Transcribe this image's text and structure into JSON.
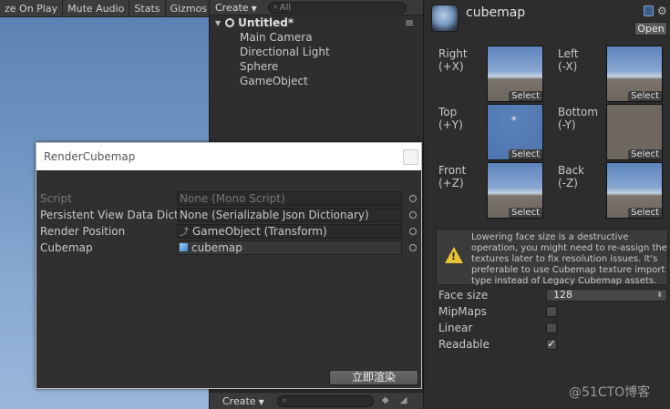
{
  "game_toolbar": {
    "items": [
      "ze On Play",
      "Mute Audio",
      "Stats",
      "Gizmos ▾"
    ]
  },
  "hierarchy": {
    "create_label": "Create",
    "search_placeholder": "All",
    "scene_name": "Untitled*",
    "items": [
      "Main Camera",
      "Directional Light",
      "Sphere",
      "GameObject"
    ],
    "bottom_create_label": "Create"
  },
  "inspector": {
    "asset_name": "cubemap",
    "open_label": "Open",
    "faces": [
      {
        "label": "Right\n(+X)",
        "select": "Select",
        "sky": "side"
      },
      {
        "label": "Left\n(-X)",
        "select": "Select",
        "sky": "side"
      },
      {
        "label": "Top\n(+Y)",
        "select": "Select",
        "sky": "top"
      },
      {
        "label": "Bottom\n(-Y)",
        "select": "Select",
        "sky": "bottom"
      },
      {
        "label": "Front\n(+Z)",
        "select": "Select",
        "sky": "side"
      },
      {
        "label": "Back\n(-Z)",
        "select": "Select",
        "sky": "side"
      }
    ],
    "warning": "Lowering face size is a destructive operation, you might need to re-assign the textures later to fix resolution issues. It's preferable to use Cubemap texture import type instead of Legacy Cubemap assets.",
    "face_size_label": "Face size",
    "face_size_value": "128",
    "mipmaps_label": "MipMaps",
    "mipmaps_checked": false,
    "linear_label": "Linear",
    "linear_checked": false,
    "readable_label": "Readable",
    "readable_checked": true
  },
  "render_window": {
    "title": "RenderCubemap",
    "fields": [
      {
        "label": "Script",
        "value": "None (Mono Script)",
        "disabled": true
      },
      {
        "label": "Persistent View Data Dicti",
        "value": "None (Serializable Json Dictionary)",
        "disabled": false
      },
      {
        "label": "Render Position",
        "value": "GameObject (Transform)",
        "disabled": false
      },
      {
        "label": "Cubemap",
        "value": "cubemap",
        "disabled": false
      }
    ],
    "button_label": "立即渲染"
  },
  "watermark": "@51CTO博客"
}
